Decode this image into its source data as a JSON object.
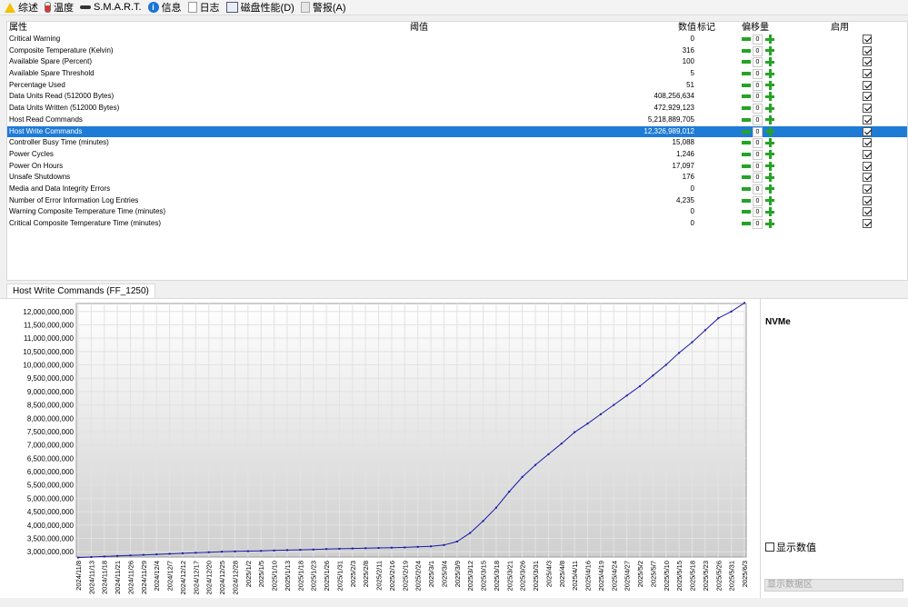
{
  "tabs": [
    {
      "label": "综述",
      "icon": "warning-icon"
    },
    {
      "label": "温度",
      "icon": "thermometer-icon"
    },
    {
      "label": "S.M.A.R.T.",
      "icon": "smart-icon"
    },
    {
      "label": "信息",
      "icon": "info-icon"
    },
    {
      "label": "日志",
      "icon": "document-icon"
    },
    {
      "label": "磁盘性能(D)",
      "icon": "chart-icon"
    },
    {
      "label": "警报(A)",
      "icon": "alarm-icon"
    }
  ],
  "table": {
    "headers": {
      "attribute": "属性",
      "threshold": "阈值",
      "value": "数值",
      "flag": "标记",
      "offset": "偏移量",
      "enabled": "启用"
    },
    "selected_row": 8,
    "rows": [
      {
        "name": "Critical Warning",
        "value": "0",
        "offset": "0"
      },
      {
        "name": "Composite Temperature (Kelvin)",
        "value": "316",
        "offset": "0"
      },
      {
        "name": "Available Spare (Percent)",
        "value": "100",
        "offset": "0"
      },
      {
        "name": "Available Spare Threshold",
        "value": "5",
        "offset": "0"
      },
      {
        "name": "Percentage Used",
        "value": "51",
        "offset": "0"
      },
      {
        "name": "Data Units Read (512000 Bytes)",
        "value": "408,256,634",
        "offset": "0"
      },
      {
        "name": "Data Units Written (512000 Bytes)",
        "value": "472,929,123",
        "offset": "0"
      },
      {
        "name": "Host Read Commands",
        "value": "5,218,889,705",
        "offset": "0"
      },
      {
        "name": "Host Write Commands",
        "value": "12,326,989,012",
        "offset": "0"
      },
      {
        "name": "Controller Busy Time (minutes)",
        "value": "15,088",
        "offset": "0"
      },
      {
        "name": "Power Cycles",
        "value": "1,246",
        "offset": "0"
      },
      {
        "name": "Power On Hours",
        "value": "17,097",
        "offset": "0"
      },
      {
        "name": "Unsafe Shutdowns",
        "value": "176",
        "offset": "0"
      },
      {
        "name": "Media and Data Integrity Errors",
        "value": "0",
        "offset": "0"
      },
      {
        "name": "Number of Error Information Log Entries",
        "value": "4,235",
        "offset": "0"
      },
      {
        "name": "Warning Composite Temperature Time (minutes)",
        "value": "0",
        "offset": "0"
      },
      {
        "name": "Critical Composite Temperature Time (minutes)",
        "value": "0",
        "offset": "0"
      }
    ]
  },
  "chart_tab_label": "Host Write Commands (FF_1250)",
  "legend": {
    "title": "NVMe",
    "show_values_label": "显示数值",
    "show_area_label": "显示数据区"
  },
  "colors": {
    "selection": "#1e7bd6",
    "series": "#1a1aa8",
    "plus_minus": "#26a326"
  },
  "chart_data": {
    "type": "line",
    "title": "Host Write Commands (FF_1250)",
    "series_name": "NVMe",
    "y_ticks": [
      "3,000,000,000",
      "3,500,000,000",
      "4,000,000,000",
      "4,500,000,000",
      "5,000,000,000",
      "5,500,000,000",
      "6,000,000,000",
      "6,500,000,000",
      "7,000,000,000",
      "7,500,000,000",
      "8,000,000,000",
      "8,500,000,000",
      "9,000,000,000",
      "9,500,000,000",
      "10,000,000,000",
      "10,500,000,000",
      "11,000,000,000",
      "11,500,000,000",
      "12,000,000,000"
    ],
    "ylim": [
      2800000000,
      12300000000
    ],
    "grid": true,
    "x_ticks": [
      "2024/11/8",
      "2024/11/13",
      "2024/11/18",
      "2024/11/21",
      "2024/11/26",
      "2024/11/29",
      "2024/12/4",
      "2024/12/7",
      "2024/12/12",
      "2024/12/17",
      "2024/12/20",
      "2024/12/25",
      "2024/12/28",
      "2025/1/2",
      "2025/1/5",
      "2025/1/10",
      "2025/1/13",
      "2025/1/18",
      "2025/1/23",
      "2025/1/26",
      "2025/1/31",
      "2025/2/3",
      "2025/2/8",
      "2025/2/11",
      "2025/2/16",
      "2025/2/19",
      "2025/2/24",
      "2025/3/1",
      "2025/3/4",
      "2025/3/9",
      "2025/3/12",
      "2025/3/15",
      "2025/3/18",
      "2025/3/21",
      "2025/3/26",
      "2025/3/31",
      "2025/4/3",
      "2025/4/8",
      "2025/4/11",
      "2025/4/16",
      "2025/4/19",
      "2025/4/24",
      "2025/4/27",
      "2025/5/2",
      "2025/5/7",
      "2025/5/10",
      "2025/5/15",
      "2025/5/18",
      "2025/5/23",
      "2025/5/26",
      "2025/5/31",
      "2025/6/3"
    ],
    "values": [
      2780000000,
      2800000000,
      2820000000,
      2840000000,
      2860000000,
      2880000000,
      2900000000,
      2920000000,
      2940000000,
      2960000000,
      2980000000,
      3000000000,
      3010000000,
      3020000000,
      3030000000,
      3045000000,
      3060000000,
      3070000000,
      3080000000,
      3100000000,
      3110000000,
      3120000000,
      3130000000,
      3140000000,
      3150000000,
      3160000000,
      3180000000,
      3200000000,
      3250000000,
      3380000000,
      3700000000,
      4150000000,
      4650000000,
      5250000000,
      5800000000,
      6250000000,
      6650000000,
      7050000000,
      7480000000,
      7800000000,
      8150000000,
      8500000000,
      8850000000,
      9200000000,
      9600000000,
      10000000000,
      10450000000,
      10850000000,
      11300000000,
      11750000000,
      12000000000,
      12320000000
    ]
  }
}
